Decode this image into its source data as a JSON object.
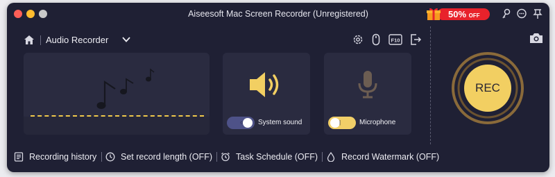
{
  "window": {
    "title": "Aiseesoft Mac Screen Recorder (Unregistered)"
  },
  "promo": {
    "discount": "50%",
    "suffix": "OFF"
  },
  "toolbar": {
    "mode_label": "Audio Recorder"
  },
  "system_sound": {
    "label": "System sound",
    "enabled": false
  },
  "microphone": {
    "label": "Microphone",
    "enabled": true
  },
  "record": {
    "label": "REC"
  },
  "bottom": {
    "history": "Recording history",
    "length": "Set record length (OFF)",
    "schedule": "Task Schedule (OFF)",
    "watermark": "Record Watermark (OFF)"
  },
  "colors": {
    "background": "#1f2034",
    "panel": "#2a2b40",
    "accent": "#f2cf62",
    "promo_red": "#e8222b"
  },
  "icons": [
    "home-icon",
    "chevron-down-icon",
    "settings-icon",
    "mouse-icon",
    "f10-hotkey-icon",
    "exit-icon",
    "gift-icon",
    "key-icon",
    "chat-icon",
    "pin-icon",
    "camera-icon",
    "speaker-icon",
    "microphone-icon",
    "music-notes-icon",
    "list-icon",
    "clock-icon",
    "alarm-icon",
    "watermark-drop-icon"
  ]
}
